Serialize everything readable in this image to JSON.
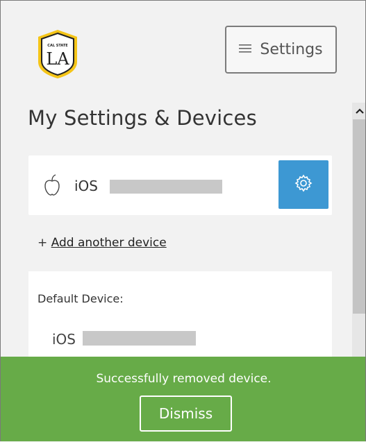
{
  "header": {
    "logo_text": "LA",
    "logo_small_text": "CAL STATE",
    "settings_button_label": "Settings",
    "settings_icon": "hamburger-icon"
  },
  "main": {
    "title": "My Settings & Devices",
    "device": {
      "icon": "apple-icon",
      "platform": "iOS",
      "gear_icon": "gear-icon"
    },
    "add_device": {
      "prefix": "+ ",
      "link_label": "Add another device"
    },
    "default_device": {
      "label": "Default Device:",
      "platform": "iOS"
    }
  },
  "toast": {
    "message": "Successfully removed device.",
    "dismiss_label": "Dismiss"
  },
  "colors": {
    "accent_blue": "#3d98d3",
    "toast_green": "#67ab48",
    "logo_gold": "#f5c518"
  }
}
